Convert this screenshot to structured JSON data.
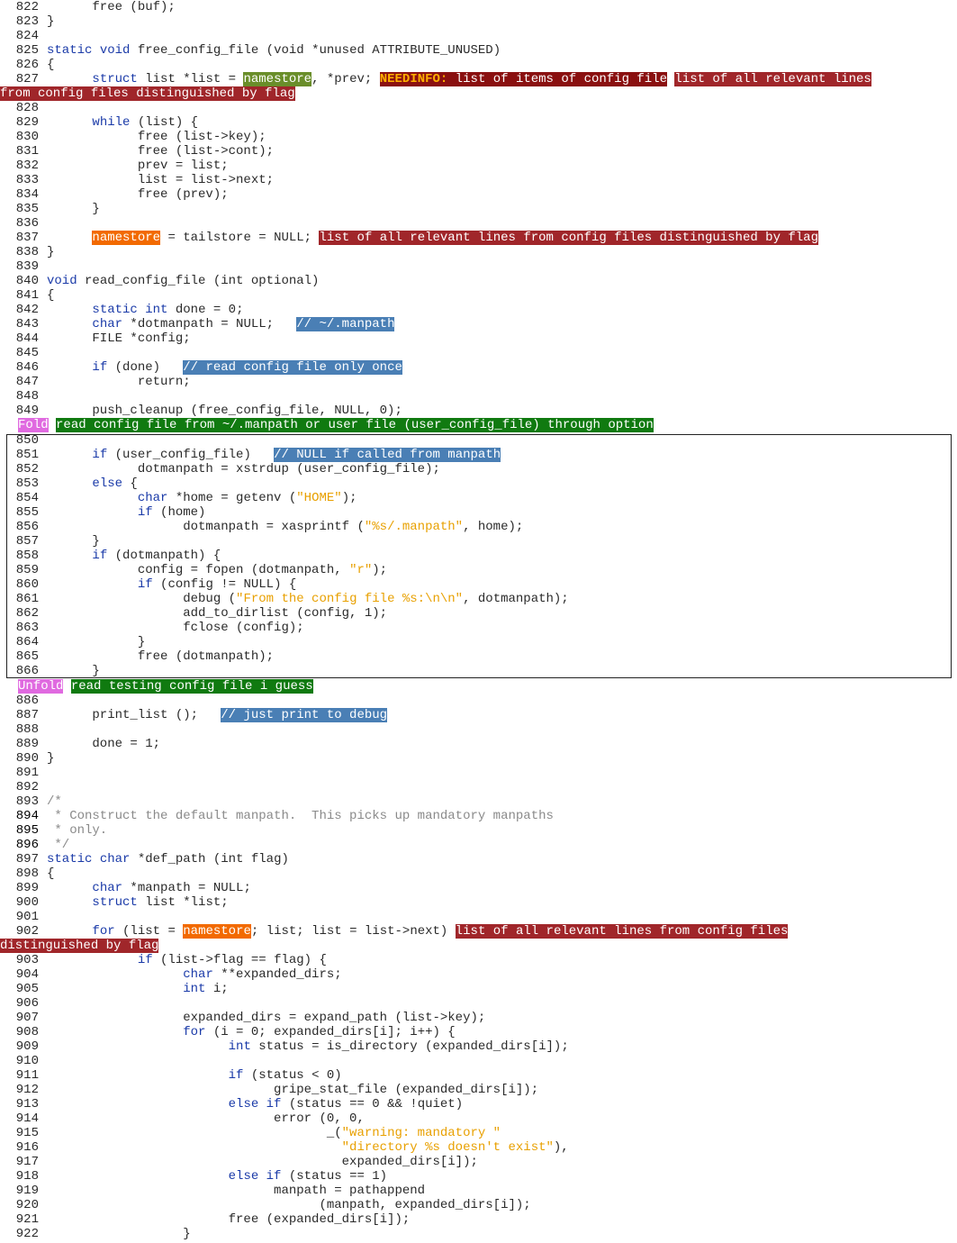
{
  "colors": {
    "keyword": "#1a3aa8",
    "string": "#e8a000",
    "comment": "#8a8a8a",
    "ann_green": "#6a8e2a",
    "ann_orange": "#f26a00",
    "ann_comment": "#4a7fb5",
    "ann_red": "#a0262a",
    "fold": "#e06ae0",
    "section": "#107a10"
  },
  "annotations": {
    "namestore": "namestore",
    "needinfo_tag": "NEEDINFO:",
    "needinfo_text": " list of items of config file",
    "relevant_lines_a": "list of all relevant lines",
    "relevant_lines_b": "from config files distinguished by flag",
    "relevant_lines_full": "list of all relevant lines from config files distinguished by flag",
    "relevant_lines_c": "list of all relevant lines from config files",
    "relevant_lines_d": "distinguished by flag",
    "cmt_manpath": "// ~/.manpath",
    "cmt_once": "// read config file only once",
    "cmt_null": "// NULL if called from manpath",
    "cmt_debug": "// just print to debug",
    "fold_label": "Fold",
    "fold_section": "read config file from ~/.manpath or user file (user_config_file) through option",
    "unfold_label": "Unfold",
    "unfold_section": "read testing config file i guess"
  },
  "lines": {
    "l822": "822",
    "l823": "823",
    "l824": "824",
    "l825": "825",
    "l826": "826",
    "l827": "827",
    "l828": "828",
    "l829": "829",
    "l830": "830",
    "l831": "831",
    "l832": "832",
    "l833": "833",
    "l834": "834",
    "l835": "835",
    "l836": "836",
    "l837": "837",
    "l838": "838",
    "l839": "839",
    "l840": "840",
    "l841": "841",
    "l842": "842",
    "l843": "843",
    "l844": "844",
    "l845": "845",
    "l846": "846",
    "l847": "847",
    "l848": "848",
    "l849": "849",
    "l850": "850",
    "l851": "851",
    "l852": "852",
    "l853": "853",
    "l854": "854",
    "l855": "855",
    "l856": "856",
    "l857": "857",
    "l858": "858",
    "l859": "859",
    "l860": "860",
    "l861": "861",
    "l862": "862",
    "l863": "863",
    "l864": "864",
    "l865": "865",
    "l866": "866",
    "l886": "886",
    "l887": "887",
    "l888": "888",
    "l889": "889",
    "l890": "890",
    "l891": "891",
    "l892": "892",
    "l893": "893",
    "l894": "894",
    "l895": "895",
    "l896": "896",
    "l897": "897",
    "l898": "898",
    "l899": "899",
    "l900": "900",
    "l901": "901",
    "l902": "902",
    "l903": "903",
    "l904": "904",
    "l905": "905",
    "l906": "906",
    "l907": "907",
    "l908": "908",
    "l909": "909",
    "l910": "910",
    "l911": "911",
    "l912": "912",
    "l913": "913",
    "l914": "914",
    "l915": "915",
    "l916": "916",
    "l917": "917",
    "l918": "918",
    "l919": "919",
    "l920": "920",
    "l921": "921",
    "l922": "922"
  },
  "code": {
    "c822": "      free (buf);",
    "c823": "}",
    "c825a": "static",
    "c825b": " ",
    "c825c": "void",
    "c825d": " free_config_file (void *unused ATTRIBUTE_UNUSED)",
    "c826": "{",
    "c827a": "      ",
    "c827b": "struct",
    "c827c": " list *list = ",
    "c827d": ", *prev; ",
    "c829a": "      ",
    "c829b": "while",
    "c829c": " (list) {",
    "c830": "            free (list->key);",
    "c831": "            free (list->cont);",
    "c832": "            prev = list;",
    "c833": "            list = list->next;",
    "c834": "            free (prev);",
    "c835": "      }",
    "c837a": "      ",
    "c837b": " = tailstore = NULL; ",
    "c838": "}",
    "c840a": "void",
    "c840b": " read_config_file (int optional)",
    "c841": "{",
    "c842a": "      ",
    "c842b": "static",
    "c842c": " ",
    "c842d": "int",
    "c842e": " done = 0;",
    "c843a": "      ",
    "c843b": "char",
    "c843c": " *dotmanpath = NULL;   ",
    "c844": "      FILE *config;",
    "c846a": "      ",
    "c846b": "if",
    "c846c": " (done)   ",
    "c847": "            return;",
    "c849": "      push_cleanup (free_config_file, NULL, 0);",
    "c851a": "      ",
    "c851b": "if",
    "c851c": " (user_config_file)   ",
    "c852": "            dotmanpath = xstrdup (user_config_file);",
    "c853a": "      ",
    "c853b": "else",
    "c853c": " {",
    "c854a": "            ",
    "c854b": "char",
    "c854c": " *home = getenv (",
    "c854d": "\"HOME\"",
    "c854e": ");",
    "c855a": "            ",
    "c855b": "if",
    "c855c": " (home)",
    "c856a": "                  dotmanpath = xasprintf (",
    "c856b": "\"%s/.manpath\"",
    "c856c": ", home);",
    "c857": "      }",
    "c858a": "      ",
    "c858b": "if",
    "c858c": " (dotmanpath) {",
    "c859a": "            config = fopen (dotmanpath, ",
    "c859b": "\"r\"",
    "c859c": ");",
    "c860a": "            ",
    "c860b": "if",
    "c860c": " (config != NULL) {",
    "c861a": "                  debug (",
    "c861b": "\"From the config file %s:\\n\\n\"",
    "c861c": ", dotmanpath);",
    "c862": "                  add_to_dirlist (config, 1);",
    "c863": "                  fclose (config);",
    "c864": "            }",
    "c865": "            free (dotmanpath);",
    "c866": "      }",
    "c887": "      print_list ();   ",
    "c889": "      done = 1;",
    "c890": "}",
    "c893": "/*",
    "c894": " * Construct the default manpath.  This picks up mandatory manpaths",
    "c895": " * only.",
    "c896": " */",
    "c897a": "static",
    "c897b": " ",
    "c897c": "char",
    "c897d": " *def_path (int flag)",
    "c898": "{",
    "c899a": "      ",
    "c899b": "char",
    "c899c": " *manpath = NULL;",
    "c900a": "      ",
    "c900b": "struct",
    "c900c": " list *list;",
    "c902a": "      ",
    "c902b": "for",
    "c902c": " (list = ",
    "c902d": "; list; list = list->next) ",
    "c903a": "            ",
    "c903b": "if",
    "c903c": " (list->flag == flag) {",
    "c904a": "                  ",
    "c904b": "char",
    "c904c": " **expanded_dirs;",
    "c905a": "                  ",
    "c905b": "int",
    "c905c": " i;",
    "c907": "                  expanded_dirs = expand_path (list->key);",
    "c908a": "                  ",
    "c908b": "for",
    "c908c": " (i = 0; expanded_dirs[i]; i++) {",
    "c909a": "                        ",
    "c909b": "int",
    "c909c": " status = is_directory (expanded_dirs[i]);",
    "c911a": "                        ",
    "c911b": "if",
    "c911c": " (status < 0)",
    "c912": "                              gripe_stat_file (expanded_dirs[i]);",
    "c913a": "                        ",
    "c913b": "else",
    "c913c": " ",
    "c913d": "if",
    "c913e": " (status == 0 && !quiet)",
    "c914": "                              error (0, 0,",
    "c915a": "                                     _(",
    "c915b": "\"warning: mandatory \"",
    "c916a": "                                       ",
    "c916b": "\"directory %s doesn't exist\"",
    "c916c": "),",
    "c917": "                                       expanded_dirs[i]);",
    "c918a": "                        ",
    "c918b": "else",
    "c918c": " ",
    "c918d": "if",
    "c918e": " (status == 1)",
    "c919": "                              manpath = pathappend",
    "c920": "                                    (manpath, expanded_dirs[i]);",
    "c921": "                        free (expanded_dirs[i]);",
    "c922": "                  }"
  }
}
